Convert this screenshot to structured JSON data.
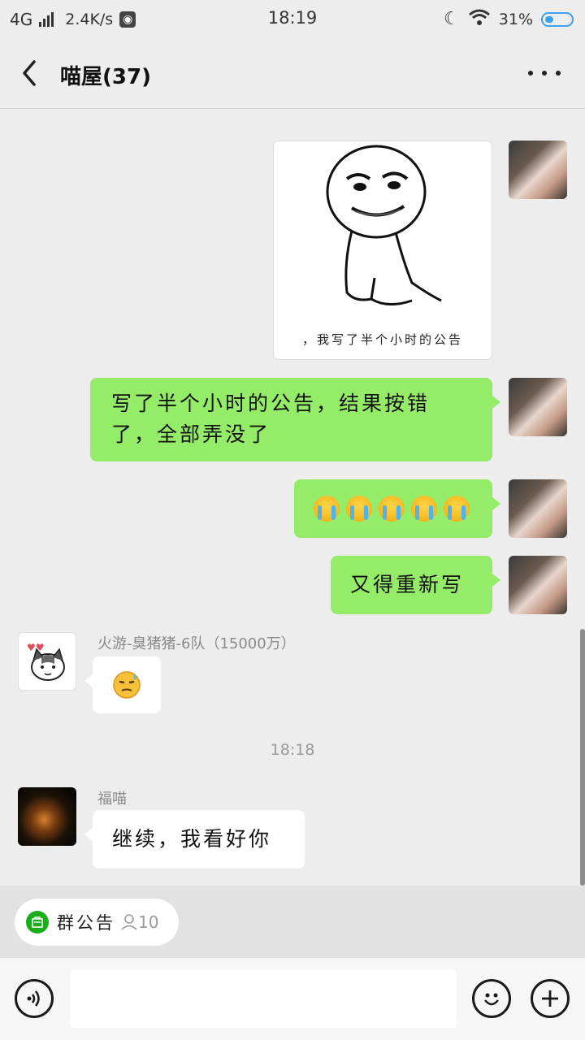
{
  "status_bar": {
    "network": "4G",
    "speed": "2.4K/s",
    "time": "18:19",
    "battery": "31%"
  },
  "nav": {
    "title": "喵屋(37)"
  },
  "messages": {
    "sticker_caption": "，我写了半个小时的公告",
    "self_text_1": "写了半个小时的公告，结果按错了，全部弄没了",
    "self_text_2": "又得重新写",
    "other_1_name": "火游-臭猪猪-6队（15000万）",
    "timestamp": "18:18",
    "other_2_name": "福喵",
    "other_2_text": "继续，我看好你"
  },
  "notice": {
    "label": "群公告",
    "count": "10"
  },
  "input": {
    "placeholder": ""
  },
  "icons": {
    "back": "chevron-left-icon",
    "more": "more-dots-icon",
    "voice": "voice-icon",
    "emoji": "smile-icon",
    "add": "plus-icon"
  },
  "colors": {
    "self_bubble": "#95ec69",
    "other_bubble": "#ffffff",
    "background": "#ededed",
    "notice_icon": "#1aad19"
  }
}
